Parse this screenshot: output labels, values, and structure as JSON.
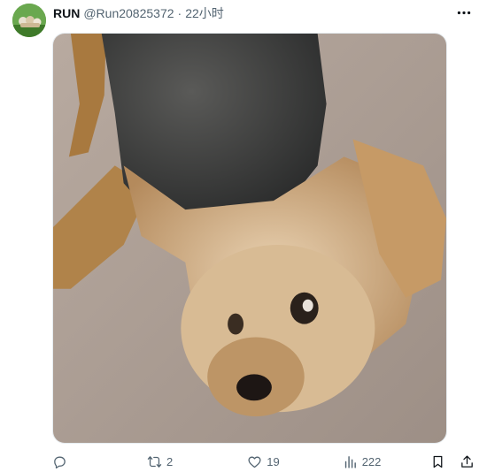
{
  "author": {
    "name": "RUN",
    "handle": "@Run20825372",
    "separator": "·",
    "time": "22小时"
  },
  "media": {
    "subject": "small terrier dog lying upside down on a carpet"
  },
  "actions": {
    "reply_count": "",
    "retweet_count": "2",
    "like_count": "19",
    "views_count": "222"
  },
  "icons": {
    "more": "more-horizontal-icon",
    "reply": "reply-icon",
    "retweet": "retweet-icon",
    "like": "heart-icon",
    "views": "views-icon",
    "bookmark": "bookmark-icon",
    "share": "share-icon"
  },
  "colors": {
    "text_primary": "#0f1419",
    "text_secondary": "#536471",
    "background": "#ffffff"
  }
}
